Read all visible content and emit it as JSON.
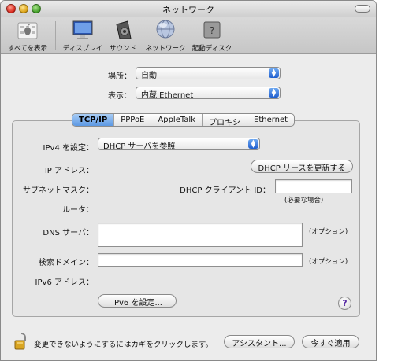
{
  "window": {
    "title": "ネットワーク"
  },
  "toolbar": {
    "items": [
      {
        "label": "すべてを表示",
        "icon": "apple-show-all-icon"
      },
      {
        "label": "ディスプレイ",
        "icon": "display-icon"
      },
      {
        "label": "サウンド",
        "icon": "speaker-icon"
      },
      {
        "label": "ネットワーク",
        "icon": "network-globe-icon"
      },
      {
        "label": "起動ディスク",
        "icon": "startup-disk-icon"
      }
    ]
  },
  "location": {
    "label": "場所：",
    "value": "自動"
  },
  "show": {
    "label": "表示：",
    "value": "内蔵 Ethernet"
  },
  "tabs": [
    {
      "label": "TCP/IP",
      "active": true
    },
    {
      "label": "PPPoE",
      "active": false
    },
    {
      "label": "AppleTalk",
      "active": false
    },
    {
      "label": "プロキシ",
      "active": false
    },
    {
      "label": "Ethernet",
      "active": false
    }
  ],
  "tcpip": {
    "ipv4_label": "IPv4 を設定：",
    "ipv4_value": "DHCP サーバを参照",
    "ip_address_label": "IP アドレス：",
    "renew_button": "DHCP リースを更新する",
    "subnet_label": "サブネットマスク：",
    "dhcp_client_id_label": "DHCP クライアント ID：",
    "dhcp_client_id_value": "",
    "if_needed": "(必要な場合)",
    "router_label": "ルータ：",
    "dns_label": "DNS サーバ：",
    "dns_value": "",
    "optional_1": "(オプション)",
    "search_domain_label": "検索ドメイン：",
    "search_domain_value": "",
    "optional_2": "(オプション)",
    "ipv6_address_label": "IPv6 アドレス：",
    "ipv6_button": "IPv6 を設定..."
  },
  "footer": {
    "lock_text": "変更できないようにするにはカギをクリックします。",
    "assistant_button": "アシスタント...",
    "apply_button": "今すぐ適用"
  }
}
